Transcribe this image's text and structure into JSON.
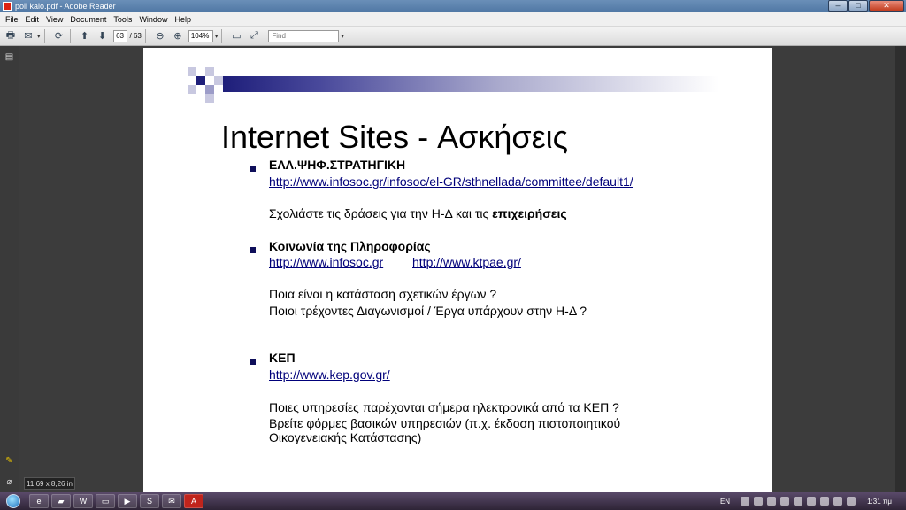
{
  "window": {
    "title": "poli kalo.pdf - Adobe Reader",
    "min_label": "–",
    "max_label": "□",
    "close_label": "✕"
  },
  "menu": [
    "File",
    "Edit",
    "View",
    "Document",
    "Tools",
    "Window",
    "Help"
  ],
  "toolbar": {
    "page_current": "63",
    "page_total": "/ 63",
    "zoom": "104%",
    "find_placeholder": "Find",
    "icons": [
      "print-icon",
      "email-icon",
      "collaborate-icon",
      "prev-page-icon",
      "next-page-icon",
      "zoom-out-icon",
      "zoom-in-icon",
      "fit-page-icon",
      "fit-width-icon"
    ]
  },
  "slide": {
    "title": "Internet Sites - Ασκήσεις",
    "s1_heading": "ΕΛΛ.ΨΗΦ.ΣΤΡΑΤΗΓΙΚΗ",
    "s1_link": "http://www.infosoc.gr/infosoc/el-GR/sthnellada/committee/default1/",
    "s1_text_pre": "Σχολιάστε τις δράσεις για την Η-Δ και τις ",
    "s1_text_bold": "επιχειρήσεις",
    "s2_heading": "Κοινωνία της Πληροφορίας",
    "s2_link1": "http://www.infosoc.gr",
    "s2_link2": "http://www.ktpae.gr/",
    "s2_line1": "Ποια είναι η κατάσταση σχετικών έργων ?",
    "s2_line2": "Ποιοι τρέχοντες Διαγωνισμοί / Έργα υπάρχουν στην Η-Δ ?",
    "s3_heading": "ΚΕΠ",
    "s3_link": "http://www.kep.gov.gr/",
    "s3_line1": "Ποιες υπηρεσίες παρέχονται σήμερα ηλεκτρονικά από τα ΚΕΠ ?",
    "s3_line2": "Βρείτε φόρμες βασικών υπηρεσιών (π.χ. έκδοση πιστοποιητικού",
    "s3_line3": "Οικογενειακής  Κατάστασης)"
  },
  "page_size_tip": "11,69 x 8,26 in",
  "taskbar": {
    "lang": "EN",
    "clock": "1:31 πμ",
    "apps": [
      "ie-icon",
      "folder-icon",
      "word-icon",
      "explorer-icon",
      "media-icon",
      "skype-icon",
      "mail-icon",
      "acrobat-icon"
    ]
  },
  "colors": {
    "title_bar": "#5a82ad",
    "header_bar_dark": "#1e1e7a",
    "bullet": "#0f0f5a",
    "link": "#00007a"
  }
}
